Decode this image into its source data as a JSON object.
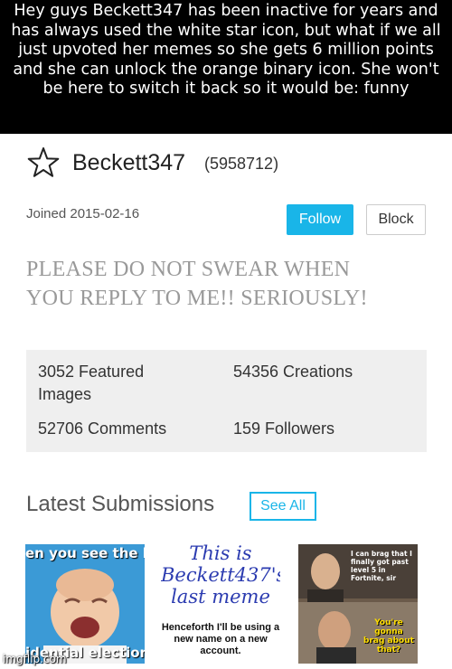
{
  "caption": {
    "text": "Hey guys Beckett347 has been inactive for years and has always used the white star icon, but what if we all just upvoted her memes so she gets 6 million points and she can unlock the orange binary icon. She won't be here to switch it back so it would be: funny"
  },
  "profile": {
    "star_icon": "star-outline-icon",
    "username": "Beckett347",
    "points": "(5958712)",
    "joined": "Joined 2015-02-16",
    "follow_label": "Follow",
    "block_label": "Block",
    "bio_line1": "PLEASE DO NOT SWEAR WHEN",
    "bio_line2": "YOU REPLY TO ME!! SERIOUSLY!"
  },
  "stats": {
    "featured_line1": "3052 Featured",
    "featured_line2": "Images",
    "creations": "54356 Creations",
    "comments": "52706 Comments",
    "followers": "159 Followers"
  },
  "latest": {
    "title": "Latest Submissions",
    "see_all_label": "See All",
    "thumbs": [
      {
        "top_text": "en you see the la",
        "bottom_text": "idential election"
      },
      {
        "hand_line1": "This is",
        "hand_line2": "Beckett437's",
        "hand_line3": "last meme",
        "type_text": "Henceforth I'll be using a new name on a new account."
      },
      {
        "top_text": "I can brag that I finally got past level 5 in Fortnite, sir",
        "bottom_text": "You're gonna brag about that?"
      }
    ]
  },
  "watermark": "imgflip.com",
  "colors": {
    "accent": "#19b5e8",
    "caption_bg": "#000000"
  }
}
